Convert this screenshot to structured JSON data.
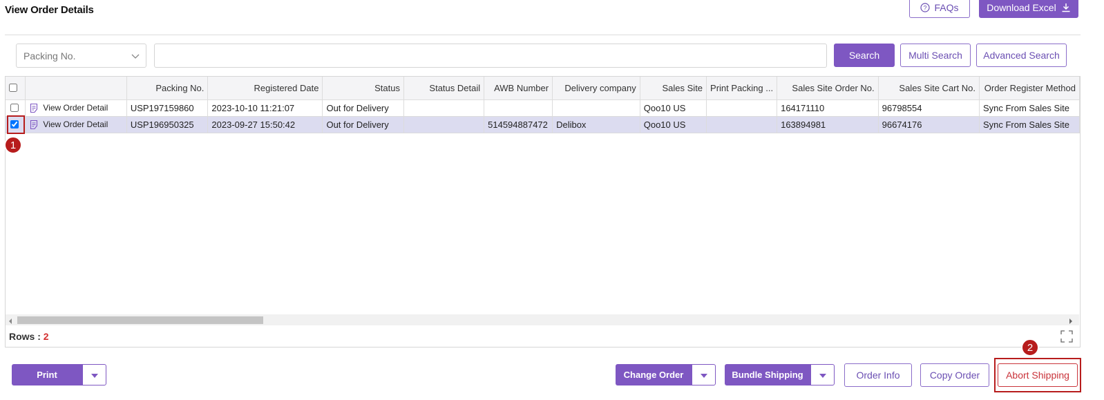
{
  "page": {
    "title": "View Order Details"
  },
  "header": {
    "faqs_label": "FAQs",
    "download_label": "Download Excel"
  },
  "search": {
    "field_select": "Packing No.",
    "input_value": "",
    "search_label": "Search",
    "multi_label": "Multi Search",
    "advanced_label": "Advanced Search"
  },
  "grid": {
    "columns": [
      "",
      "",
      "Packing No.",
      "Registered Date",
      "Status",
      "Status Detail",
      "AWB Number",
      "Delivery company",
      "Sales Site",
      "Print Packing ...",
      "Sales Site Order No.",
      "Sales Site Cart No.",
      "Order Register Method"
    ],
    "rows": [
      {
        "checked": false,
        "detail": "View Order Detail",
        "packing_no": "USP197159860",
        "registered": "2023-10-10 11:21:07",
        "status": "Out for Delivery",
        "status_detail": "",
        "awb": "",
        "delivery": "",
        "site": "Qoo10 US",
        "print_packing": "",
        "order_no": "164171110",
        "cart_no": "96798554",
        "method": "Sync From Sales Site"
      },
      {
        "checked": true,
        "detail": "View Order Detail",
        "packing_no": "USP196950325",
        "registered": "2023-09-27 15:50:42",
        "status": "Out for Delivery",
        "status_detail": "",
        "awb": "514594887472",
        "delivery": "Delibox",
        "site": "Qoo10 US",
        "print_packing": "",
        "order_no": "163894981",
        "cart_no": "96674176",
        "method": "Sync From Sales Site"
      }
    ],
    "rows_label": "Rows :",
    "rows_count": "2"
  },
  "footer": {
    "print_label": "Print",
    "change_order_label": "Change Order",
    "bundle_label": "Bundle Shipping",
    "order_info_label": "Order Info",
    "copy_order_label": "Copy Order",
    "abort_label": "Abort Shipping"
  },
  "annotations": {
    "step1": "1",
    "step2": "2"
  },
  "colors": {
    "accent": "#7e57c2",
    "highlight": "#b71c1c",
    "selected_row": "#dcdcf0"
  }
}
